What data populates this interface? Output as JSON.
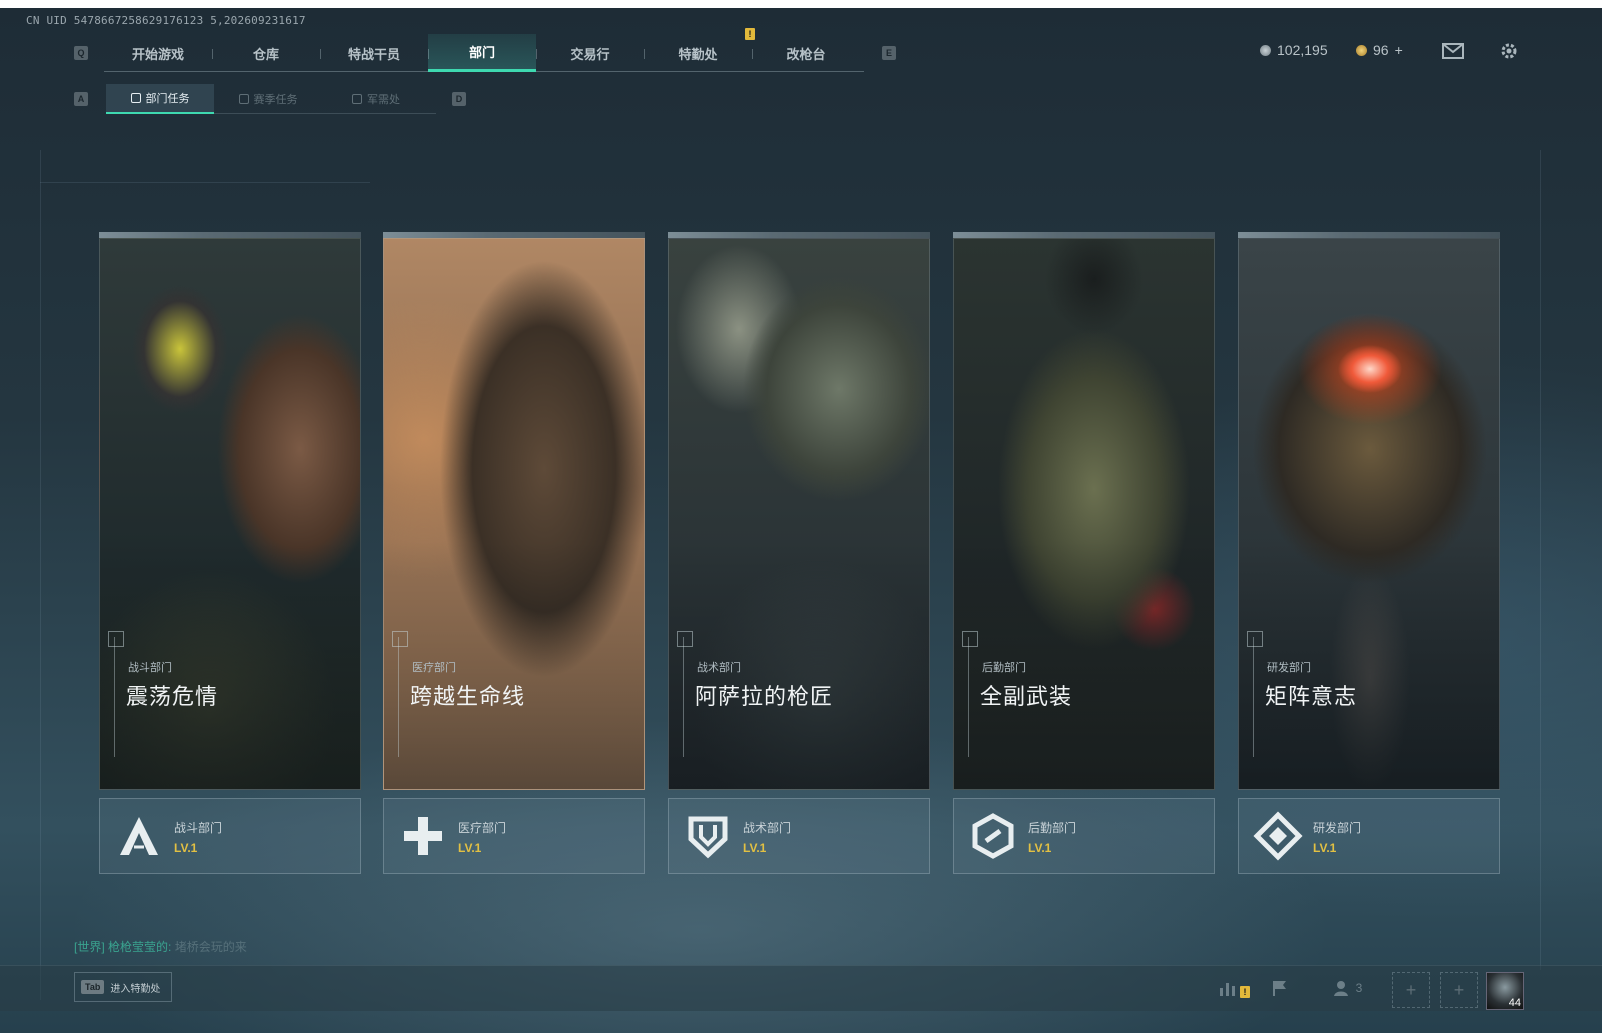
{
  "uid": "CN UID 5478667258629176123 5,202609231617",
  "nav": {
    "left_key": "Q",
    "right_key": "E",
    "tabs": [
      {
        "label": "开始游戏",
        "active": false
      },
      {
        "label": "仓库",
        "active": false
      },
      {
        "label": "特战干员",
        "active": false
      },
      {
        "label": "部门",
        "active": true
      },
      {
        "label": "交易行",
        "active": false
      },
      {
        "label": "特勤处",
        "active": false
      },
      {
        "label": "改枪台",
        "active": false
      }
    ],
    "alert_mark": "!"
  },
  "subnav": {
    "left_key": "A",
    "right_key": "D",
    "tabs": [
      {
        "label": "部门任务",
        "active": true
      },
      {
        "label": "赛季任务",
        "active": false
      },
      {
        "label": "军需处",
        "active": false
      }
    ]
  },
  "currency": {
    "primary_amount": "102,195",
    "secondary_amount": "96",
    "add_symbol": "+"
  },
  "cards": [
    {
      "dept": "战斗部门",
      "title": "震荡危情",
      "foot_dept": "战斗部门",
      "level": "LV.1",
      "icon": "combat-dept-icon"
    },
    {
      "dept": "医疗部门",
      "title": "跨越生命线",
      "foot_dept": "医疗部门",
      "level": "LV.1",
      "icon": "medical-dept-icon"
    },
    {
      "dept": "战术部门",
      "title": "阿萨拉的枪匠",
      "foot_dept": "战术部门",
      "level": "LV.1",
      "icon": "tactical-dept-icon"
    },
    {
      "dept": "后勤部门",
      "title": "全副武装",
      "foot_dept": "后勤部门",
      "level": "LV.1",
      "icon": "logistics-dept-icon"
    },
    {
      "dept": "研发部门",
      "title": "矩阵意志",
      "foot_dept": "研发部门",
      "level": "LV.1",
      "icon": "research-dept-icon"
    }
  ],
  "chat": {
    "channel": "[世界]",
    "sender": "枪枪莹莹的:",
    "message": "堵桥会玩的来"
  },
  "bottom": {
    "tab_key": "Tab",
    "tab_label": "进入特勤处",
    "friends_count": "3",
    "alert_mark": "!",
    "player_level": "44"
  },
  "colors": {
    "accent": "#3ed9b0",
    "level_gold": "#e2c043",
    "warning": "#e2b93b"
  }
}
